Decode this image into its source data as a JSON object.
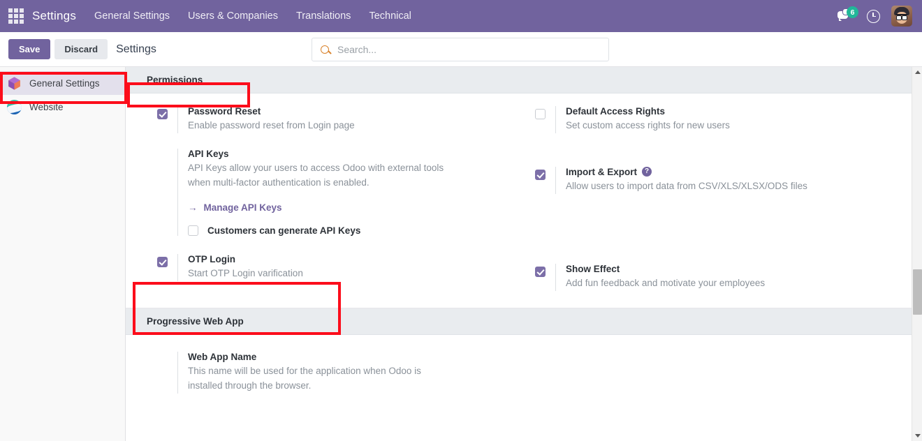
{
  "navbar": {
    "apps_icon": "apps-grid-icon",
    "brand": "Settings",
    "menu": [
      {
        "label": "General Settings"
      },
      {
        "label": "Users & Companies"
      },
      {
        "label": "Translations"
      },
      {
        "label": "Technical"
      }
    ],
    "messages_badge": "6",
    "messages_icon": "messages-icon",
    "activities_icon": "clock-icon",
    "avatar_icon": "user-avatar"
  },
  "control_panel": {
    "save_label": "Save",
    "discard_label": "Discard",
    "title": "Settings",
    "search_placeholder": "Search...",
    "search_value": "",
    "search_icon": "search-icon"
  },
  "sidebar": {
    "items": [
      {
        "label": "General Settings",
        "icon": "settings-hexagon-icon",
        "active": true
      },
      {
        "label": "Website",
        "icon": "website-globe-icon",
        "active": false
      }
    ]
  },
  "sections": {
    "permissions": {
      "heading": "Permissions",
      "left": [
        {
          "title": "Password Reset",
          "desc": "Enable password reset from Login page",
          "checked": true,
          "has_checkbox": true
        },
        {
          "title": "API Keys",
          "desc": "API Keys allow your users to access Odoo with external tools when multi-factor authentication is enabled.",
          "checked": false,
          "has_checkbox": false,
          "link": "Manage API Keys",
          "link_arrow": "arrow-right-icon",
          "sub_checkbox": {
            "label": "Customers can generate API Keys",
            "checked": false
          }
        },
        {
          "title": "OTP Login",
          "desc": "Start OTP Login varification",
          "checked": true,
          "has_checkbox": true
        }
      ],
      "right": [
        {
          "title": "Default Access Rights",
          "desc": "Set custom access rights for new users",
          "checked": false,
          "has_checkbox": true
        },
        {
          "title": "Import & Export",
          "desc": "Allow users to import data from CSV/XLS/XLSX/ODS files",
          "checked": true,
          "has_checkbox": true,
          "help_icon": "help-question-icon",
          "help_glyph": "?"
        },
        {
          "title": "Show Effect",
          "desc": "Add fun feedback and motivate your employees",
          "checked": true,
          "has_checkbox": true
        }
      ]
    },
    "pwa": {
      "heading": "Progressive Web App",
      "left": [
        {
          "title": "Web App Name",
          "desc": "This name will be used for the application when Odoo is installed through the browser.",
          "checked": false,
          "has_checkbox": false
        }
      ]
    }
  },
  "scrollbar": {
    "up_icon": "scroll-up-arrow-icon",
    "down_icon": "scroll-down-arrow-icon"
  },
  "colors": {
    "brand_purple": "#71639e",
    "checkbox_purple": "#7c6fa8",
    "annotation_red": "#fc0d1b",
    "badge_green": "#21b799",
    "section_header_grey": "#e9ecef",
    "search_icon_orange": "#d9822b"
  }
}
